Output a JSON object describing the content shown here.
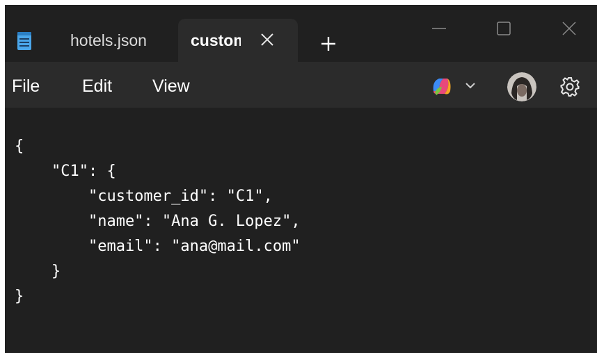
{
  "window": {
    "tabs": [
      {
        "label": "hotels.json",
        "active": false
      },
      {
        "label": "customers.json",
        "active": true
      }
    ],
    "accent_color": "#5ab0f0"
  },
  "menu": {
    "file": "File",
    "edit": "Edit",
    "view": "View"
  },
  "toolbar_icons": [
    "copilot-icon",
    "chevron-down-icon",
    "avatar",
    "gear-icon"
  ],
  "editor": {
    "lines": [
      "{",
      "    \"C1\": {",
      "        \"customer_id\": \"C1\",",
      "        \"name\": \"Ana G. Lopez\",",
      "        \"email\": \"ana@mail.com\"",
      "    }",
      "}"
    ]
  }
}
